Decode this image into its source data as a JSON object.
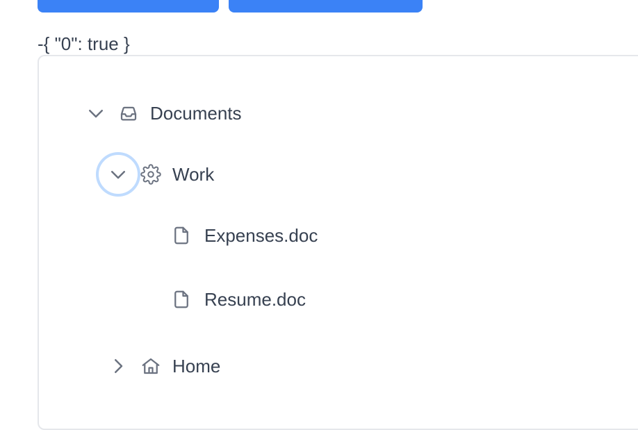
{
  "state_text": "-{ \"0\": true }",
  "tree": {
    "documents": {
      "label": "Documents",
      "icon": "inbox-icon",
      "expanded": true
    },
    "work": {
      "label": "Work",
      "icon": "gear-icon",
      "expanded": true
    },
    "expenses": {
      "label": "Expenses.doc",
      "icon": "file-icon"
    },
    "resume": {
      "label": "Resume.doc",
      "icon": "file-icon"
    },
    "home": {
      "label": "Home",
      "icon": "home-icon",
      "expanded": false
    }
  },
  "colors": {
    "accent": "#3b82f6",
    "focus_ring": "#bfdbfe",
    "text": "#374151",
    "icon": "#6b7280",
    "border": "#e5e7eb"
  }
}
